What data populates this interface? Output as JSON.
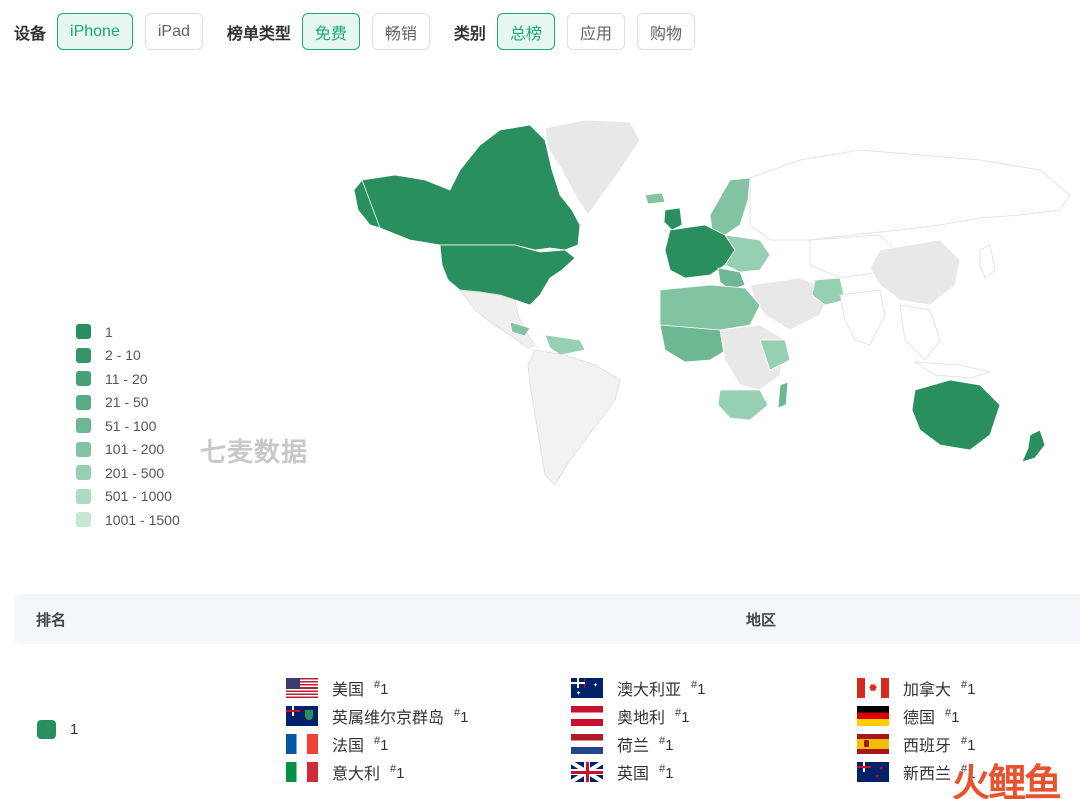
{
  "filters": {
    "device": {
      "label": "设备",
      "options": [
        "iPhone",
        "iPad"
      ],
      "selected": "iPhone"
    },
    "list_type": {
      "label": "榜单类型",
      "options": [
        "免费",
        "畅销"
      ],
      "selected": "免费"
    },
    "category": {
      "label": "类别",
      "options": [
        "总榜",
        "应用",
        "购物"
      ],
      "selected": "总榜"
    }
  },
  "legend": [
    {
      "label": "1",
      "color": "#2a8f5e"
    },
    {
      "label": "2 - 10",
      "color": "#35956a"
    },
    {
      "label": "11 - 20",
      "color": "#47a077"
    },
    {
      "label": "21 - 50",
      "color": "#5aab85"
    },
    {
      "label": "51 - 100",
      "color": "#6db793"
    },
    {
      "label": "101 - 200",
      "color": "#82c3a2"
    },
    {
      "label": "201 - 500",
      "color": "#97cfb2"
    },
    {
      "label": "501 - 1000",
      "color": "#aedbc3"
    },
    {
      "label": "1001 - 1500",
      "color": "#c6e7d5"
    }
  ],
  "watermark": "七麦数据",
  "table": {
    "header_rank": "排名",
    "header_region": "地区",
    "rank_label": "1",
    "countries": [
      {
        "name": "美国",
        "rank": "1",
        "flag": "us-flag"
      },
      {
        "name": "澳大利亚",
        "rank": "1",
        "flag": "au-flag"
      },
      {
        "name": "加拿大",
        "rank": "1",
        "flag": "ca-flag"
      },
      {
        "name": "英属维尔京群岛",
        "rank": "1",
        "flag": "vg-flag"
      },
      {
        "name": "奥地利",
        "rank": "1",
        "flag": "at-flag"
      },
      {
        "name": "德国",
        "rank": "1",
        "flag": "de-flag"
      },
      {
        "name": "法国",
        "rank": "1",
        "flag": "fr-flag"
      },
      {
        "name": "荷兰",
        "rank": "1",
        "flag": "nl-flag"
      },
      {
        "name": "西班牙",
        "rank": "1",
        "flag": "es-flag"
      },
      {
        "name": "意大利",
        "rank": "1",
        "flag": "it-flag"
      },
      {
        "name": "英国",
        "rank": "1",
        "flag": "gb-flag"
      },
      {
        "name": "新西兰",
        "rank": "1",
        "flag": "nz-flag"
      }
    ]
  },
  "corner_logo": "火鲤鱼",
  "colors": {
    "accent": "#1fa67a",
    "rank1": "#2a8f5e",
    "unranked": "#e8e8e8"
  }
}
